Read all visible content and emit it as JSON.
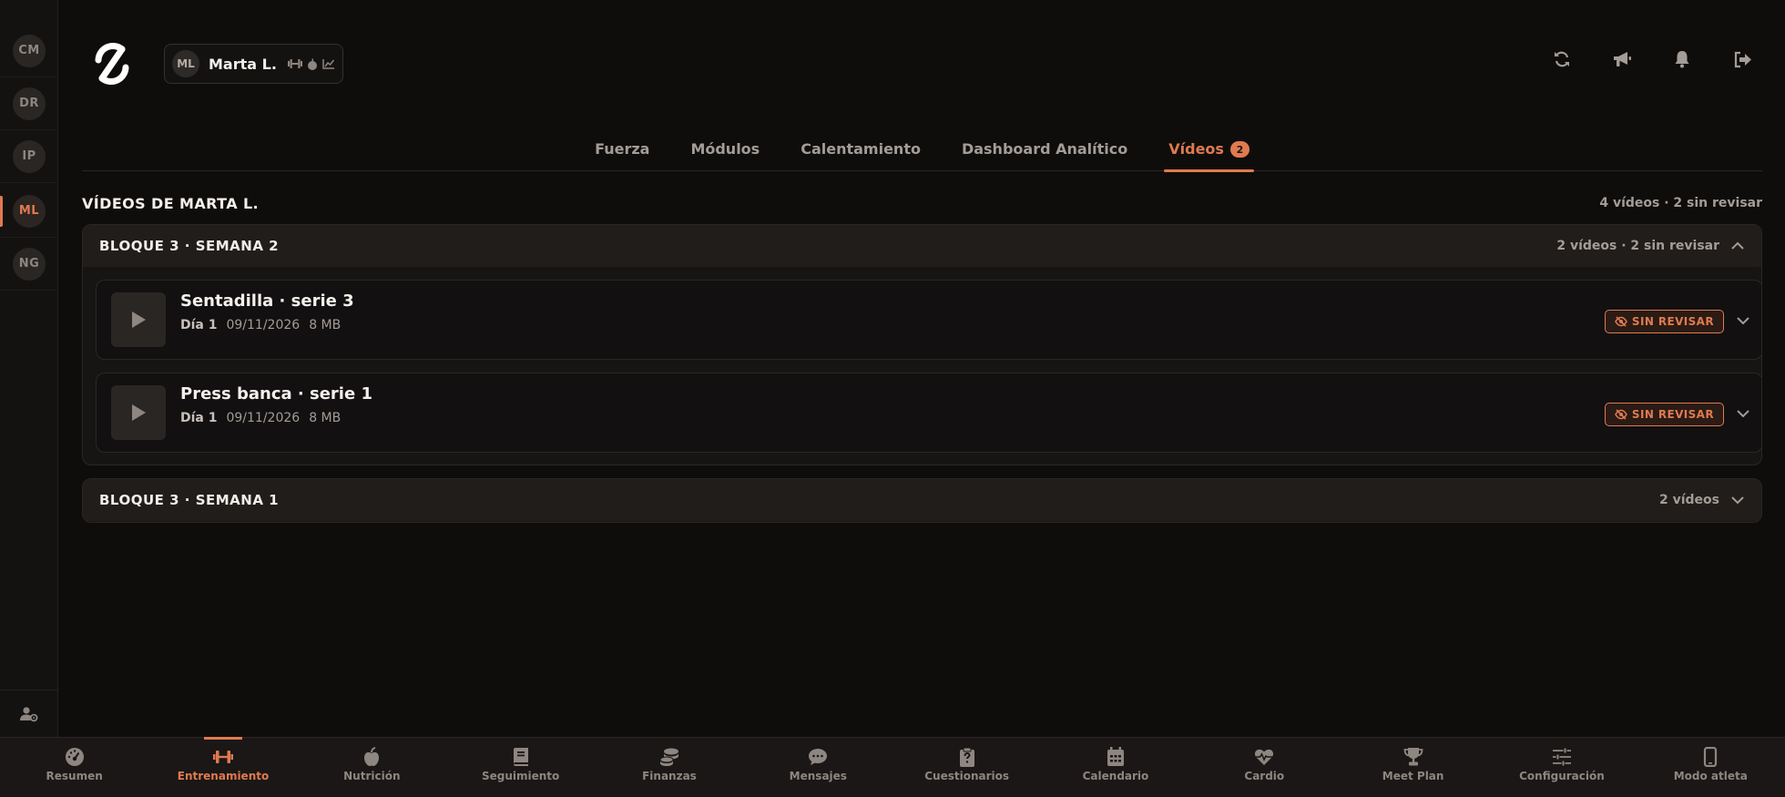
{
  "clients": [
    {
      "initials": "CM",
      "active": false
    },
    {
      "initials": "DR",
      "active": false
    },
    {
      "initials": "IP",
      "active": false
    },
    {
      "initials": "ML",
      "active": true
    },
    {
      "initials": "NG",
      "active": false
    }
  ],
  "header": {
    "athlete_initials": "ML",
    "athlete_name": "Marta L.",
    "athlete_icons": [
      "dumbbell-icon",
      "apple-icon",
      "chart-line-icon"
    ],
    "actions": [
      "refresh-icon",
      "megaphone-icon",
      "bell-icon",
      "logout-icon"
    ]
  },
  "tabs": [
    {
      "label": "Fuerza",
      "active": false,
      "badge": ""
    },
    {
      "label": "Módulos",
      "active": false,
      "badge": ""
    },
    {
      "label": "Calentamiento",
      "active": false,
      "badge": ""
    },
    {
      "label": "Dashboard Analítico",
      "active": false,
      "badge": ""
    },
    {
      "label": "Vídeos",
      "active": true,
      "badge": "2"
    }
  ],
  "section": {
    "title": "VÍDEOS DE MARTA L.",
    "summary": "4 vídeos · 2 sin revisar"
  },
  "blocks": [
    {
      "title": "BLOQUE 3 · SEMANA 2",
      "summary": "2 vídeos · 2 sin revisar",
      "expanded": true,
      "videos": [
        {
          "title": "Sentadilla · serie 3",
          "day": "Día 1",
          "date": "09/11/2026",
          "size": "8 MB",
          "status": "SIN REVISAR"
        },
        {
          "title": "Press banca · serie 1",
          "day": "Día 1",
          "date": "09/11/2026",
          "size": "8 MB",
          "status": "SIN REVISAR"
        }
      ]
    },
    {
      "title": "BLOQUE 3 · SEMANA 1",
      "summary": "2 vídeos",
      "expanded": false,
      "videos": []
    }
  ],
  "bottom_nav": [
    {
      "label": "Resumen",
      "icon": "gauge-icon",
      "active": false
    },
    {
      "label": "Entrenamiento",
      "icon": "dumbbell-icon",
      "active": true
    },
    {
      "label": "Nutrición",
      "icon": "apple-icon",
      "active": false
    },
    {
      "label": "Seguimiento",
      "icon": "book-icon",
      "active": false
    },
    {
      "label": "Finanzas",
      "icon": "coins-icon",
      "active": false
    },
    {
      "label": "Mensajes",
      "icon": "chat-icon",
      "active": false
    },
    {
      "label": "Cuestionarios",
      "icon": "clipboard-question-icon",
      "active": false
    },
    {
      "label": "Calendario",
      "icon": "calendar-icon",
      "active": false
    },
    {
      "label": "Cardio",
      "icon": "heart-pulse-icon",
      "active": false
    },
    {
      "label": "Meet Plan",
      "icon": "trophy-icon",
      "active": false
    },
    {
      "label": "Configuración",
      "icon": "sliders-icon",
      "active": false
    },
    {
      "label": "Modo atleta",
      "icon": "mobile-icon",
      "active": false
    }
  ],
  "colors": {
    "accent": "#e07a4f",
    "background": "#0f0d0c",
    "surface": "#171514",
    "text_primary": "#f4efeb",
    "text_muted": "#a49c96"
  }
}
